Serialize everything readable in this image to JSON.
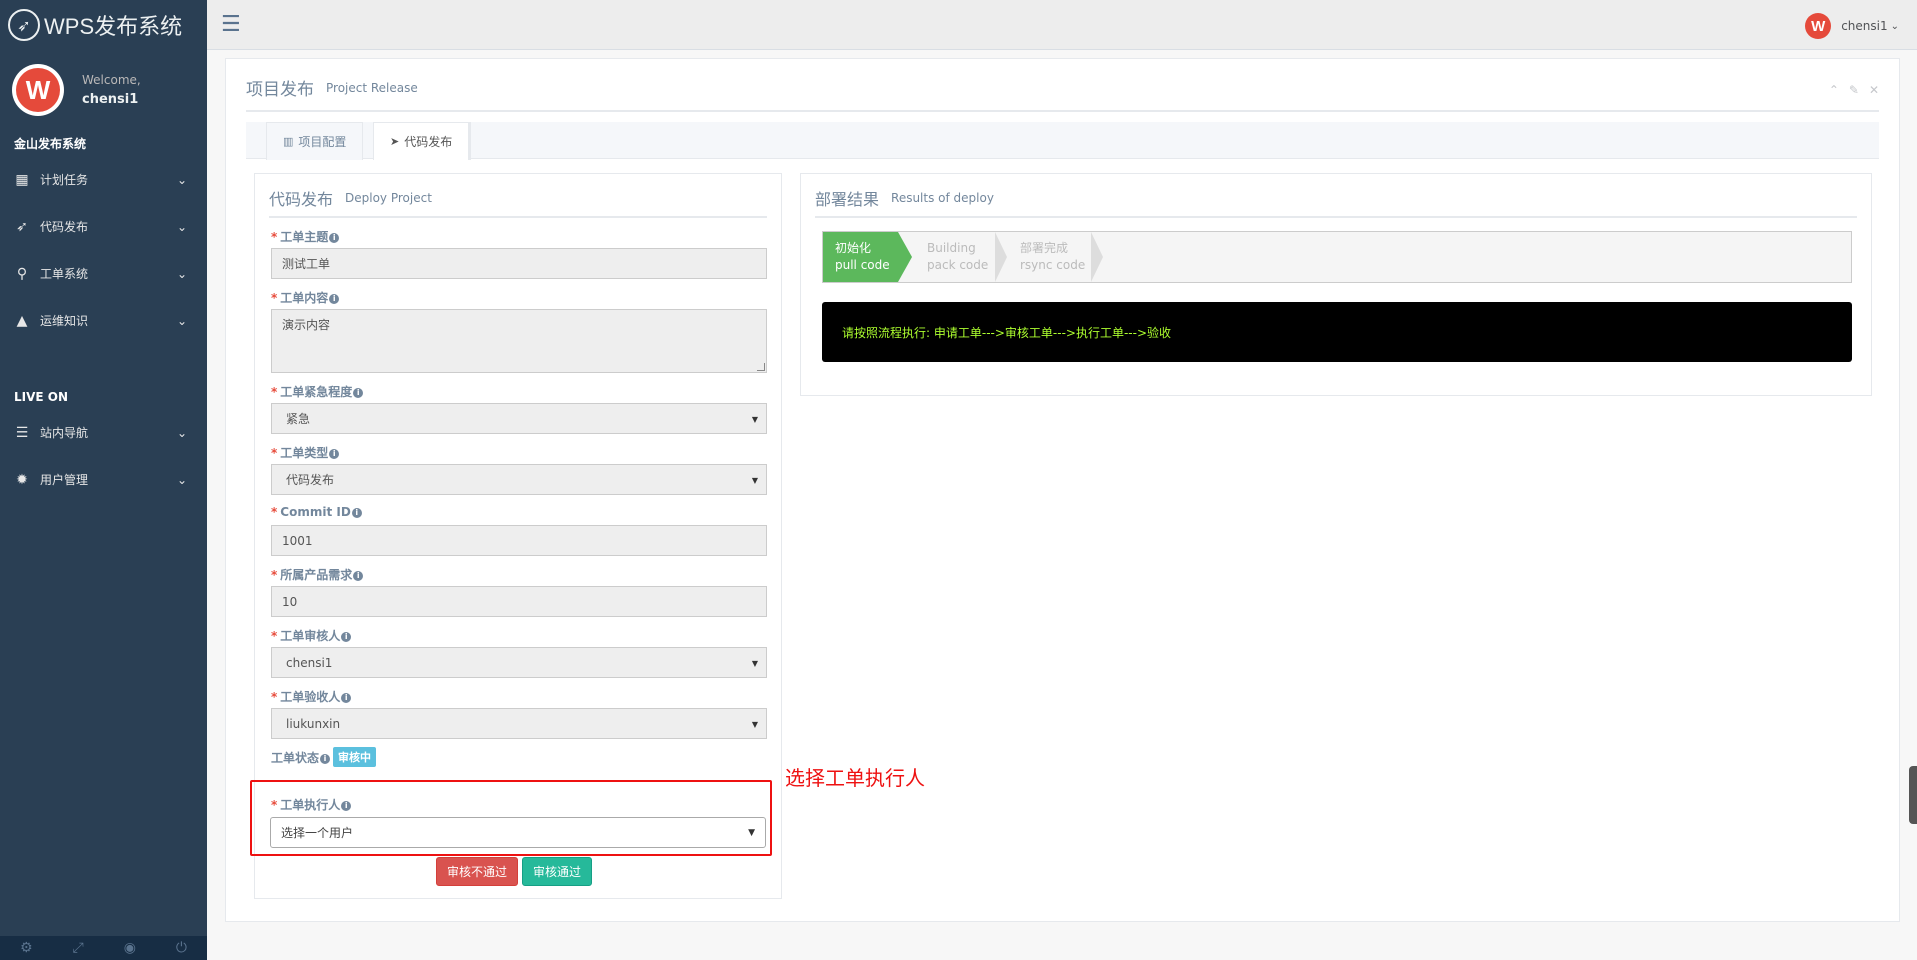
{
  "brand": {
    "title": "WPS发布系统",
    "logo_icon": "rocket-icon"
  },
  "profile": {
    "welcome": "Welcome,",
    "username": "chensi1"
  },
  "sidebar": {
    "section1": "金山发布系统",
    "section2": "LIVE ON",
    "items": [
      {
        "label": "计划任务",
        "icon": "calendar-icon"
      },
      {
        "label": "代码发布",
        "icon": "rocket-icon"
      },
      {
        "label": "工单系统",
        "icon": "sitemap-icon"
      },
      {
        "label": "运维知识",
        "icon": "graduation-cap-icon"
      },
      {
        "label": "站内导航",
        "icon": "bars-icon"
      },
      {
        "label": "用户管理",
        "icon": "bug-icon"
      }
    ],
    "footer_icons": [
      "gear-icon",
      "fullscreen-icon",
      "eye-slash-icon",
      "power-icon"
    ]
  },
  "topnav": {
    "user": "chensi1"
  },
  "panel": {
    "title": "项目发布",
    "subtitle": "Project Release",
    "tabs": [
      {
        "label": "项目配置",
        "icon": "bar-chart-icon"
      },
      {
        "label": "代码发布",
        "icon": "paper-plane-icon"
      }
    ]
  },
  "deploy": {
    "title": "代码发布",
    "subtitle": "Deploy Project",
    "fields": {
      "subject_label": "工单主题",
      "subject_value": "测试工单",
      "content_label": "工单内容",
      "content_value": "演示内容",
      "urgency_label": "工单紧急程度",
      "urgency_value": "紧急",
      "type_label": "工单类型",
      "type_value": "代码发布",
      "commit_label": "Commit ID",
      "commit_value": "1001",
      "product_label": "所属产品需求",
      "product_value": "10",
      "reviewer_label": "工单审核人",
      "reviewer_value": "chensi1",
      "acceptor_label": "工单验收人",
      "acceptor_value": "liukunxin",
      "status_label": "工单状态",
      "status_value": "审核中",
      "executor_label": "工单执行人",
      "executor_placeholder": "选择一个用户"
    },
    "buttons": {
      "reject": "审核不通过",
      "approve": "审核通过"
    }
  },
  "annotation": "选择工单执行人",
  "results": {
    "title": "部署结果",
    "subtitle": "Results of deploy",
    "steps": [
      {
        "line1": "初始化",
        "line2": "pull code",
        "active": true
      },
      {
        "line1": "Building",
        "line2": "pack code",
        "active": false
      },
      {
        "line1": "部署完成",
        "line2": "rsync code",
        "active": false
      }
    ],
    "console": "请按照流程执行: 申请工单--->审核工单--->执行工单--->验收"
  },
  "colors": {
    "sidebar": "#2A3F54",
    "step_active": "#5CB85C",
    "console_text": "#ADFF2F",
    "highlight": "#EE1111",
    "btn_danger": "#D9534F",
    "btn_success": "#26B99A",
    "badge": "#5BC0DE"
  }
}
